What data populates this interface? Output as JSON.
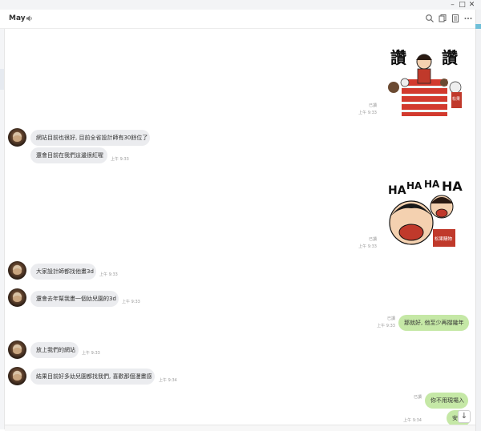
{
  "window": {
    "minimize": "–",
    "maximize": "□",
    "close": "✕"
  },
  "header": {
    "title": "May",
    "icons": [
      "speaker-icon",
      "search-icon",
      "copy-icon",
      "note-icon",
      "more-icon"
    ]
  },
  "stickers": [
    {
      "name": "praise-sticker",
      "status": "已讀",
      "time": "上午 9:33",
      "words": [
        "讚",
        "讚"
      ],
      "sign": "松果"
    },
    {
      "name": "haha-sticker",
      "status": "已讀",
      "time": "上午 9:33",
      "words": [
        "HA",
        "HA",
        "HA",
        "HA"
      ],
      "sign": "松果購物"
    }
  ],
  "messages": [
    {
      "side": "in",
      "text": "網站目前也很好, 目前全省設計師有30餘位了",
      "time": ""
    },
    {
      "side": "in",
      "text": "還會目前在我們這邊很紅喔",
      "time": "上午 9:33"
    },
    {
      "side": "in",
      "text": "大家設計師都找他畫3d",
      "time": "上午 9:33"
    },
    {
      "side": "in",
      "text": "還會去年幫我畫一個幼兒園的3d",
      "time": "上午 9:33"
    },
    {
      "side": "out",
      "text": "那就好, 他至少再撐幾年",
      "status": "已讀",
      "time": "上午 9:33"
    },
    {
      "side": "in",
      "text": "放上我們的網站",
      "time": "上午 9:33"
    },
    {
      "side": "in",
      "text": "結果目前好多幼兒園都找我們, 喜歡那個漫畫感",
      "time": "上午 9:34"
    },
    {
      "side": "out",
      "text": "你不用現場入",
      "status": "已讀",
      "time": "上午 9:34"
    },
    {
      "side": "out",
      "text": "安",
      "status": "",
      "time": ""
    }
  ],
  "scroll_down": "↓"
}
